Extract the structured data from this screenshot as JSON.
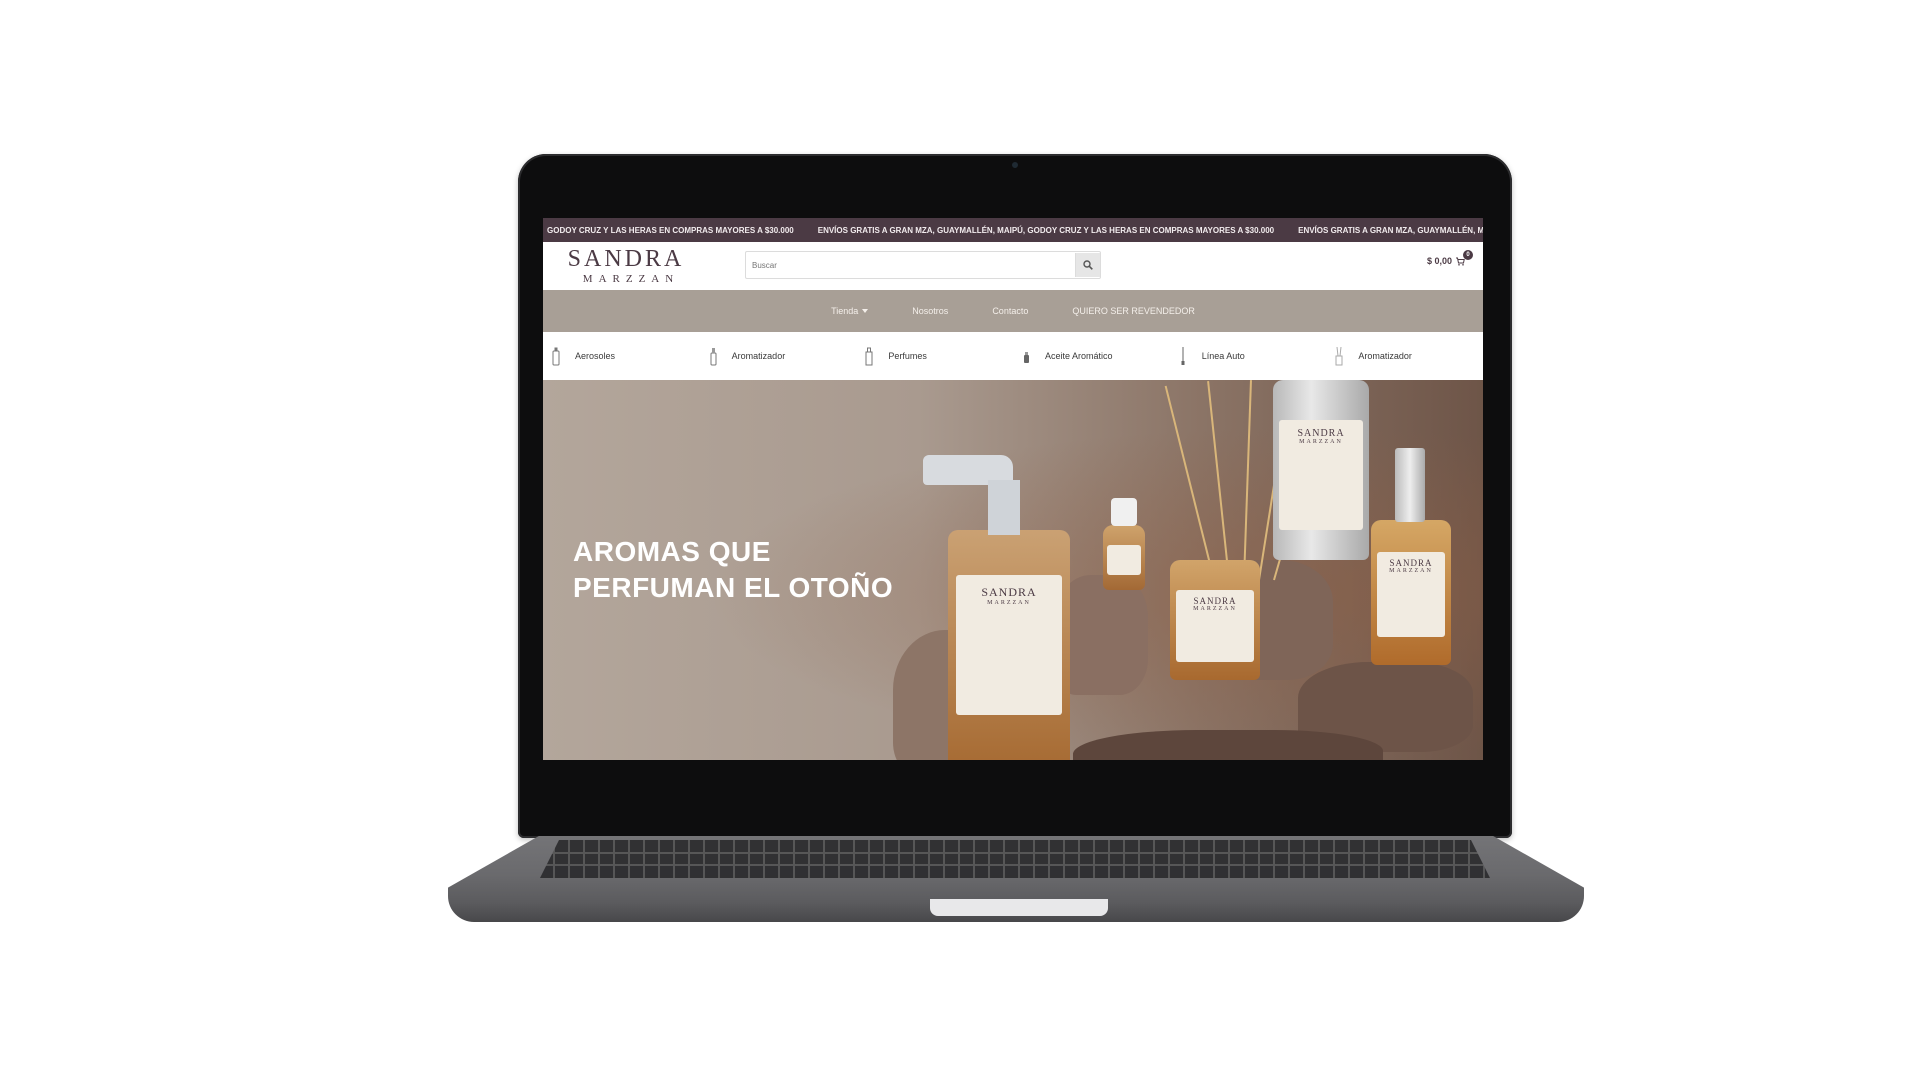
{
  "announcement": {
    "items": [
      "GODOY CRUZ Y LAS HERAS EN COMPRAS MAYORES A $30.000",
      "ENVÍOS GRATIS A GRAN MZA, GUAYMALLÉN, MAIPÚ, GODOY CRUZ Y LAS HERAS EN COMPRAS MAYORES A $30.000",
      "ENVÍOS GRATIS A GRAN MZA, GUAYMALLÉN, MAIPÚ, GODOY CRUZ Y LAS HERAS EN CO"
    ]
  },
  "brand": {
    "name": "SANDRA",
    "sub": "MARZZAN"
  },
  "search": {
    "placeholder": "Buscar"
  },
  "cart": {
    "total": "$ 0,00",
    "count": "0"
  },
  "nav": {
    "items": [
      {
        "label": "Tienda",
        "has_dropdown": true
      },
      {
        "label": "Nosotros"
      },
      {
        "label": "Contacto"
      },
      {
        "label": "QUIERO SER REVENDEDOR"
      }
    ]
  },
  "categories": [
    {
      "label": "Aerosoles",
      "icon": "aerosol-icon"
    },
    {
      "label": "Aromatizador",
      "icon": "spray-bottle-icon"
    },
    {
      "label": "Perfumes",
      "icon": "perfume-icon"
    },
    {
      "label": "Aceite Aromático",
      "icon": "oil-bottle-icon"
    },
    {
      "label": "Línea Auto",
      "icon": "car-freshener-icon"
    },
    {
      "label": "Aromatizador",
      "icon": "diffuser-icon"
    }
  ],
  "hero": {
    "title_line1": "AROMAS QUE",
    "title_line2": "PERFUMAN EL OTOÑO"
  },
  "colors": {
    "brand": "#4b3a44",
    "nav_bg": "#a89f96",
    "hero_text": "#ffffff"
  }
}
